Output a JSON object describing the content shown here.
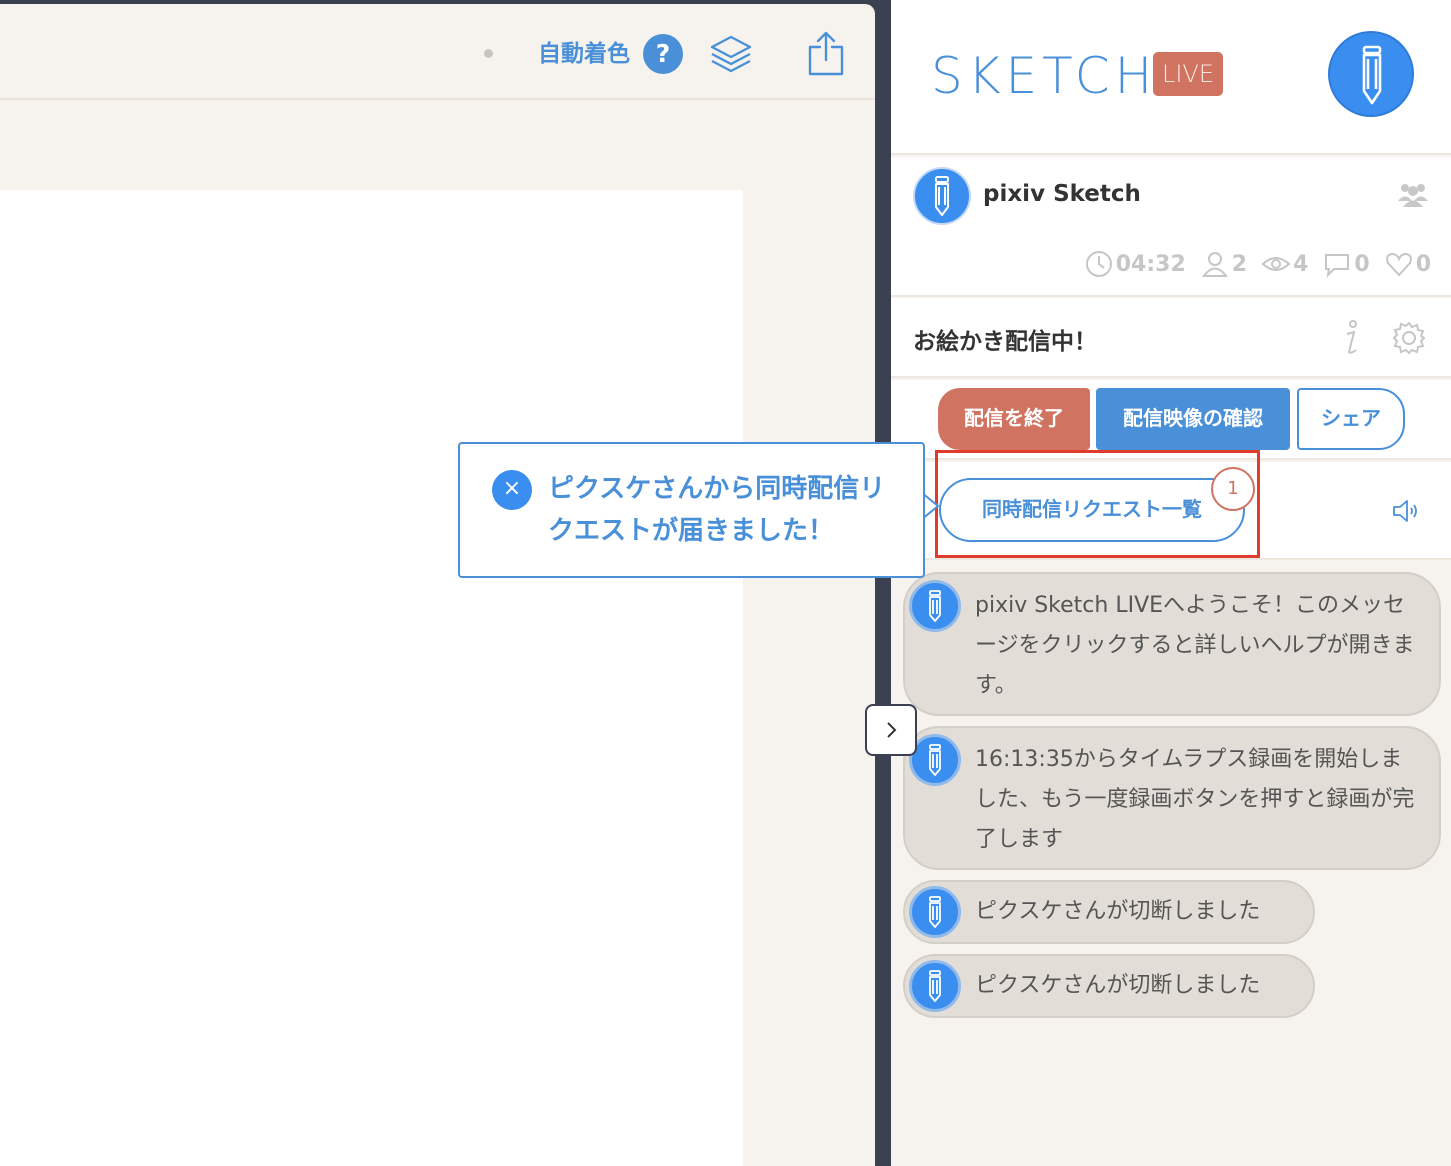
{
  "toolbar": {
    "autocolor_label": "自動着色",
    "help_label": "?",
    "icons": [
      "dot-indicator",
      "help-icon",
      "layers-icon",
      "share-icon"
    ]
  },
  "sidebar": {
    "logo": "SKETCH",
    "live_badge": "LIVE",
    "channel": {
      "name": "pixiv Sketch",
      "stats": {
        "elapsed": "04:32",
        "participants": "2",
        "viewers": "4",
        "comments": "0",
        "likes": "0"
      }
    },
    "stream_title": "お絵かき配信中！",
    "actions": {
      "end_label": "配信を終了",
      "preview_label": "配信映像の確認",
      "share_label": "シェア"
    },
    "request": {
      "button_label": "同時配信リクエスト一覧",
      "count": "1"
    },
    "messages": [
      {
        "text": "pixiv Sketch LIVEへようこそ！このメッセージをクリックすると詳しいヘルプが開きます。"
      },
      {
        "text": "16:13:35からタイムラプス録画を開始しました、もう一度録画ボタンを押すと録画が完了します"
      },
      {
        "text": "ピクスケさんが切断しました"
      },
      {
        "text": "ピクスケさんが切断しました"
      }
    ]
  },
  "toast": {
    "close_label": "×",
    "message": "ピクスケさんから同時配信リクエストが届きました！"
  },
  "collapse": {
    "label": ">"
  },
  "colors": {
    "accent": "#4a90d9",
    "live": "#d07461",
    "highlight": "#e03b2c",
    "panel_bg": "#f6f3ef",
    "frame": "#3b4150"
  }
}
